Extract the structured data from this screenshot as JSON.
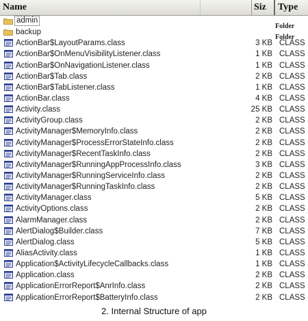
{
  "columns": {
    "name": "Name",
    "size": "Siz",
    "type": "Type"
  },
  "rows": [
    {
      "name": "admin",
      "size": "",
      "type": "",
      "kind": "folder",
      "selected": true
    },
    {
      "name": "backup",
      "size": "",
      "type": "Folder",
      "kind": "folder"
    },
    {
      "name": "ActionBar$LayoutParams.class",
      "size": "3 KB",
      "type": "CLASS",
      "kind": "file"
    },
    {
      "name": "ActionBar$OnMenuVisibilityListener.class",
      "size": "1 KB",
      "type": "CLASS",
      "kind": "file"
    },
    {
      "name": "ActionBar$OnNavigationListener.class",
      "size": "1 KB",
      "type": "CLASS",
      "kind": "file"
    },
    {
      "name": "ActionBar$Tab.class",
      "size": "2 KB",
      "type": "CLASS",
      "kind": "file"
    },
    {
      "name": "ActionBar$TabListener.class",
      "size": "1 KB",
      "type": "CLASS",
      "kind": "file"
    },
    {
      "name": "ActionBar.class",
      "size": "4 KB",
      "type": "CLASS",
      "kind": "file"
    },
    {
      "name": "Activity.class",
      "size": "25 KB",
      "type": "CLASS",
      "kind": "file"
    },
    {
      "name": "ActivityGroup.class",
      "size": "2 KB",
      "type": "CLASS",
      "kind": "file"
    },
    {
      "name": "ActivityManager$MemoryInfo.class",
      "size": "2 KB",
      "type": "CLASS",
      "kind": "file"
    },
    {
      "name": "ActivityManager$ProcessErrorStateInfo.class",
      "size": "2 KB",
      "type": "CLASS",
      "kind": "file"
    },
    {
      "name": "ActivityManager$RecentTaskInfo.class",
      "size": "2 KB",
      "type": "CLASS",
      "kind": "file"
    },
    {
      "name": "ActivityManager$RunningAppProcessInfo.class",
      "size": "3 KB",
      "type": "CLASS",
      "kind": "file"
    },
    {
      "name": "ActivityManager$RunningServiceInfo.class",
      "size": "2 KB",
      "type": "CLASS",
      "kind": "file"
    },
    {
      "name": "ActivityManager$RunningTaskInfo.class",
      "size": "2 KB",
      "type": "CLASS",
      "kind": "file"
    },
    {
      "name": "ActivityManager.class",
      "size": "5 KB",
      "type": "CLASS",
      "kind": "file"
    },
    {
      "name": "ActivityOptions.class",
      "size": "2 KB",
      "type": "CLASS",
      "kind": "file"
    },
    {
      "name": "AlarmManager.class",
      "size": "2 KB",
      "type": "CLASS",
      "kind": "file"
    },
    {
      "name": "AlertDialog$Builder.class",
      "size": "7 KB",
      "type": "CLASS",
      "kind": "file"
    },
    {
      "name": "AlertDialog.class",
      "size": "5 KB",
      "type": "CLASS",
      "kind": "file"
    },
    {
      "name": "AliasActivity.class",
      "size": "1 KB",
      "type": "CLASS",
      "kind": "file"
    },
    {
      "name": "Application$ActivityLifecycleCallbacks.class",
      "size": "1 KB",
      "type": "CLASS",
      "kind": "file"
    },
    {
      "name": "Application.class",
      "size": "2 KB",
      "type": "CLASS",
      "kind": "file"
    },
    {
      "name": "ApplicationErrorReport$AnrInfo.class",
      "size": "2 KB",
      "type": "CLASS",
      "kind": "file"
    },
    {
      "name": "ApplicationErrorReport$BatteryInfo.class",
      "size": "2 KB",
      "type": "CLASS",
      "kind": "file"
    }
  ],
  "folder_type_label": "Folder",
  "caption": "2. Internal Structure of app",
  "colors": {
    "folder": "#e8c25a",
    "file_icon": "#2a3f8f"
  }
}
